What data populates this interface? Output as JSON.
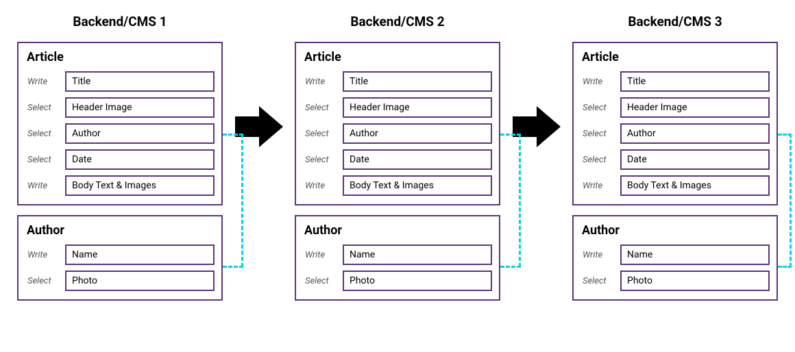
{
  "columns": [
    {
      "header": "Backend/CMS 1",
      "article": {
        "title": "Article",
        "rows": [
          {
            "label": "Write",
            "field": "Title"
          },
          {
            "label": "Select",
            "field": "Header Image"
          },
          {
            "label": "Select",
            "field": "Author"
          },
          {
            "label": "Select",
            "field": "Date"
          },
          {
            "label": "Write",
            "field": "Body Text & Images"
          }
        ]
      },
      "author": {
        "title": "Author",
        "rows": [
          {
            "label": "Write",
            "field": "Name"
          },
          {
            "label": "Select",
            "field": "Photo"
          }
        ]
      }
    },
    {
      "header": "Backend/CMS 2",
      "article": {
        "title": "Article",
        "rows": [
          {
            "label": "Write",
            "field": "Title"
          },
          {
            "label": "Select",
            "field": "Header Image"
          },
          {
            "label": "Select",
            "field": "Author"
          },
          {
            "label": "Select",
            "field": "Date"
          },
          {
            "label": "Write",
            "field": "Body Text & Images"
          }
        ]
      },
      "author": {
        "title": "Author",
        "rows": [
          {
            "label": "Write",
            "field": "Name"
          },
          {
            "label": "Select",
            "field": "Photo"
          }
        ]
      }
    },
    {
      "header": "Backend/CMS 3",
      "article": {
        "title": "Article",
        "rows": [
          {
            "label": "Write",
            "field": "Title"
          },
          {
            "label": "Select",
            "field": "Header Image"
          },
          {
            "label": "Select",
            "field": "Author"
          },
          {
            "label": "Select",
            "field": "Date"
          },
          {
            "label": "Write",
            "field": "Body Text & Images"
          }
        ]
      },
      "author": {
        "title": "Author",
        "rows": [
          {
            "label": "Write",
            "field": "Name"
          },
          {
            "label": "Select",
            "field": "Photo"
          }
        ]
      }
    }
  ],
  "colors": {
    "purple": "#5d327f",
    "cyan": "#00d4e6"
  }
}
